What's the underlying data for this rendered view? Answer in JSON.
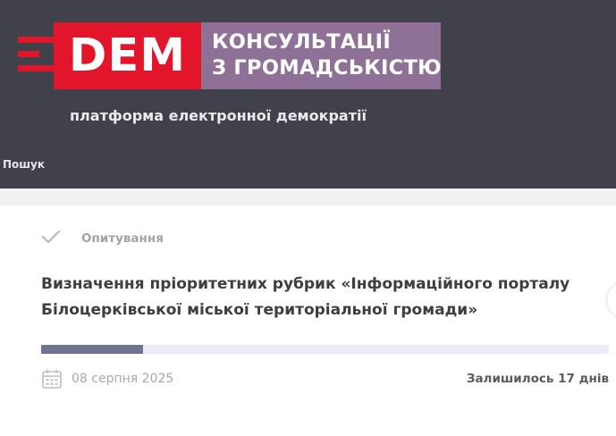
{
  "brand": {
    "logo_text": "DEM",
    "title_line1": "КОНСУЛЬТАЦІЇ",
    "title_line2": "З ГРОМАДСЬКІСТЮ",
    "tagline": "платформа електронної демократії",
    "colors": {
      "red": "#e3152a",
      "purple": "#8f7096",
      "header_bg": "#41414b"
    }
  },
  "nav": {
    "search_label": "Пошук"
  },
  "poll": {
    "category": "Опитування",
    "category_icon": "check-icon",
    "title_line1": "Визначення пріоритетних рубрик «Інформаційного порталу",
    "title_line2": "Білоцерківської міської територіальної громади»",
    "progress_fraction": 0.18,
    "date_icon": "calendar-icon",
    "date": "08 серпня 2025",
    "remaining": "Залишилось 17 днів"
  }
}
